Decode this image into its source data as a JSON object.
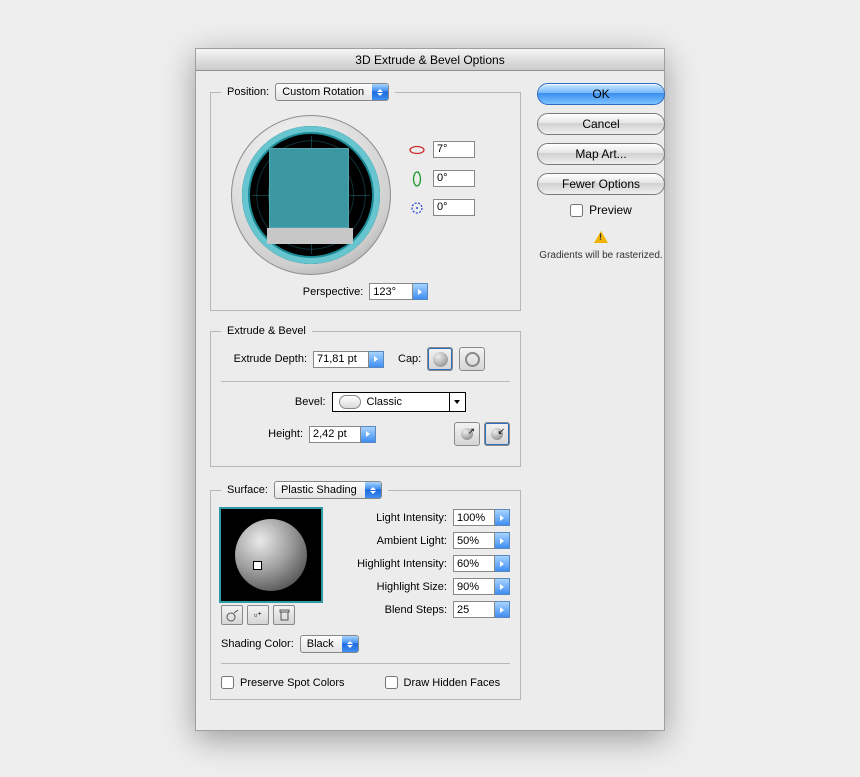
{
  "title": "3D Extrude & Bevel Options",
  "position": {
    "legend": "Position:",
    "rotation_preset": "Custom Rotation",
    "rot_x": "7°",
    "rot_y": "0°",
    "rot_z": "0°",
    "perspective_label": "Perspective:",
    "perspective": "123°"
  },
  "extrude": {
    "legend": "Extrude & Bevel",
    "depth_label": "Extrude Depth:",
    "depth": "71,81 pt",
    "cap_label": "Cap:",
    "bevel_label": "Bevel:",
    "bevel": "Classic",
    "height_label": "Height:",
    "height": "2,42 pt"
  },
  "surface": {
    "legend": "Surface:",
    "shading": "Plastic Shading",
    "light_intensity_label": "Light Intensity:",
    "light_intensity": "100%",
    "ambient_label": "Ambient Light:",
    "ambient": "50%",
    "highlight_intensity_label": "Highlight Intensity:",
    "highlight_intensity": "60%",
    "highlight_size_label": "Highlight Size:",
    "highlight_size": "90%",
    "blend_steps_label": "Blend Steps:",
    "blend_steps": "25",
    "shading_color_label": "Shading Color:",
    "shading_color": "Black",
    "preserve_spot": "Preserve Spot Colors",
    "hidden_faces": "Draw Hidden Faces"
  },
  "buttons": {
    "ok": "OK",
    "cancel": "Cancel",
    "map_art": "Map Art...",
    "fewer": "Fewer Options",
    "preview": "Preview"
  },
  "warning": "Gradients will be rasterized."
}
